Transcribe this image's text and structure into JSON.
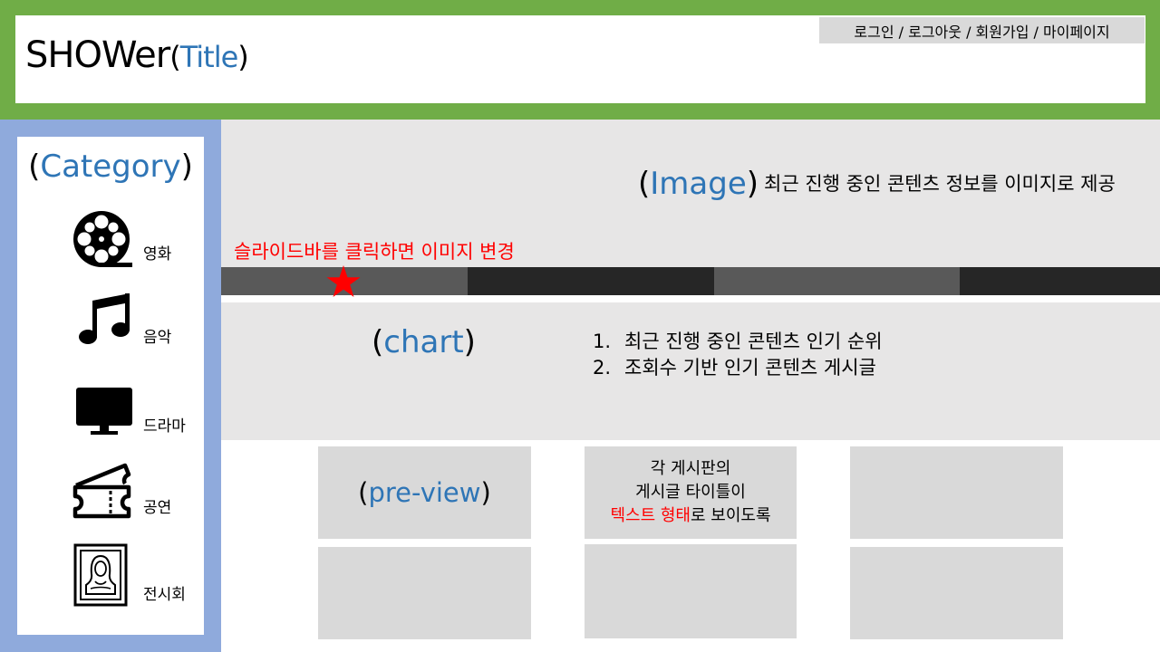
{
  "header": {
    "title": "SHOWer",
    "title_paren_open": "(",
    "title_accent": "Title",
    "title_paren_close": ")",
    "auth_links": "로그인 / 로그아웃 / 회원가입 / 마이페이지"
  },
  "sidebar": {
    "title_open": "(",
    "title_accent": "Category",
    "title_close": ")",
    "items": [
      {
        "label": "영화",
        "icon": "film-reel-icon"
      },
      {
        "label": "음악",
        "icon": "music-note-icon"
      },
      {
        "label": "드라마",
        "icon": "monitor-icon"
      },
      {
        "label": "공연",
        "icon": "ticket-icon"
      },
      {
        "label": "전시회",
        "icon": "framed-portrait-icon"
      }
    ]
  },
  "banner": {
    "label_open": "(",
    "label_accent": "Image",
    "label_close": ")",
    "description": "최근 진행 중인 콘텐츠 정보를 이미지로 제공",
    "slide_note": "슬라이드바를 클릭하면 이미지 변경",
    "slide_segments": [
      "active",
      "inactive",
      "active",
      "inactive"
    ],
    "colors": {
      "active": "#595959",
      "inactive": "#262626",
      "marker": "#ff0000"
    }
  },
  "chart": {
    "label_open": "(",
    "label_accent": "chart",
    "label_close": ")",
    "items": [
      {
        "num": "1.",
        "text": "최근 진행 중인 콘텐츠 인기 순위"
      },
      {
        "num": "2.",
        "text": "조회수 기반 인기 콘텐츠 게시글"
      }
    ]
  },
  "preview": {
    "label_open": "(",
    "label_accent": "pre-view",
    "label_close": ")",
    "note_line1": "각 게시판의",
    "note_line2": "게시글 타이틀이",
    "note_line3_red": "텍스트 형태",
    "note_line3_rest": "로 보이도록"
  },
  "colors": {
    "header_bg": "#70ad47",
    "sidebar_bg": "#8faadc",
    "section_bg": "#e7e6e6",
    "preview_bg": "#d9d9d9",
    "accent": "#2e75b6",
    "highlight": "#ff0000"
  }
}
